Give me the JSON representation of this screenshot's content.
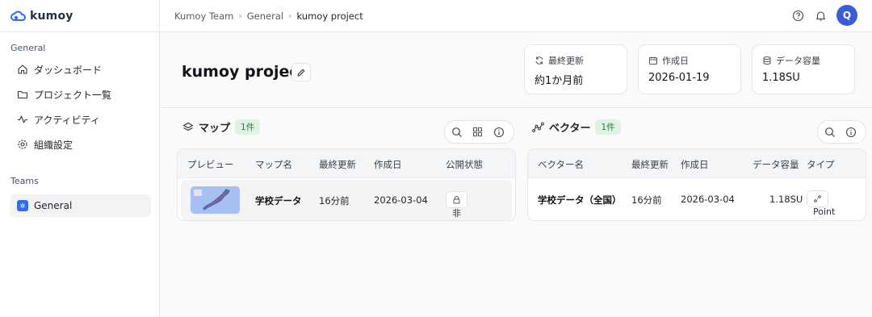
{
  "app": {
    "logo_text": "kumoy"
  },
  "sidebar": {
    "general_heading": "General",
    "items": [
      {
        "label": "ダッシュボード",
        "icon": "home-icon"
      },
      {
        "label": "プロジェクト一覧",
        "icon": "folder-icon"
      },
      {
        "label": "アクティビティ",
        "icon": "activity-icon"
      },
      {
        "label": "組織設定",
        "icon": "gear-icon"
      }
    ],
    "teams_heading": "Teams",
    "team": {
      "label": "General",
      "icon": "team-icon"
    }
  },
  "breadcrumb": [
    "Kumoy Team",
    "General",
    "kumoy project"
  ],
  "header": {
    "avatar_letter": "Q",
    "title": "kumoy project",
    "stats": [
      {
        "label": "最終更新",
        "value": "約1か月前",
        "icon": "refresh-icon"
      },
      {
        "label": "作成日",
        "value": "2026-01-19",
        "icon": "calendar-icon"
      },
      {
        "label": "データ容量",
        "value": "1.18SU",
        "icon": "database-icon"
      }
    ]
  },
  "maps": {
    "title": "マップ",
    "count": "1件",
    "columns": [
      "プレビュー",
      "マップ名",
      "最終更新",
      "作成日",
      "公開状態"
    ],
    "rows": [
      {
        "name": "学校データ",
        "updated": "16分前",
        "created": "2026-03-04",
        "status": "非公開"
      }
    ]
  },
  "vectors": {
    "title": "ベクター",
    "count": "1件",
    "columns": [
      "ベクター名",
      "最終更新",
      "作成日",
      "データ容量",
      "タイプ"
    ],
    "rows": [
      {
        "name": "学校データ（全国）",
        "updated": "16分前",
        "created": "2026-03-04",
        "size": "1.18SU",
        "type": "Point"
      }
    ]
  },
  "colors": {
    "accent": "#3b5bdb",
    "badge_bg": "#dff3e5",
    "badge_text": "#2c7a3f"
  }
}
